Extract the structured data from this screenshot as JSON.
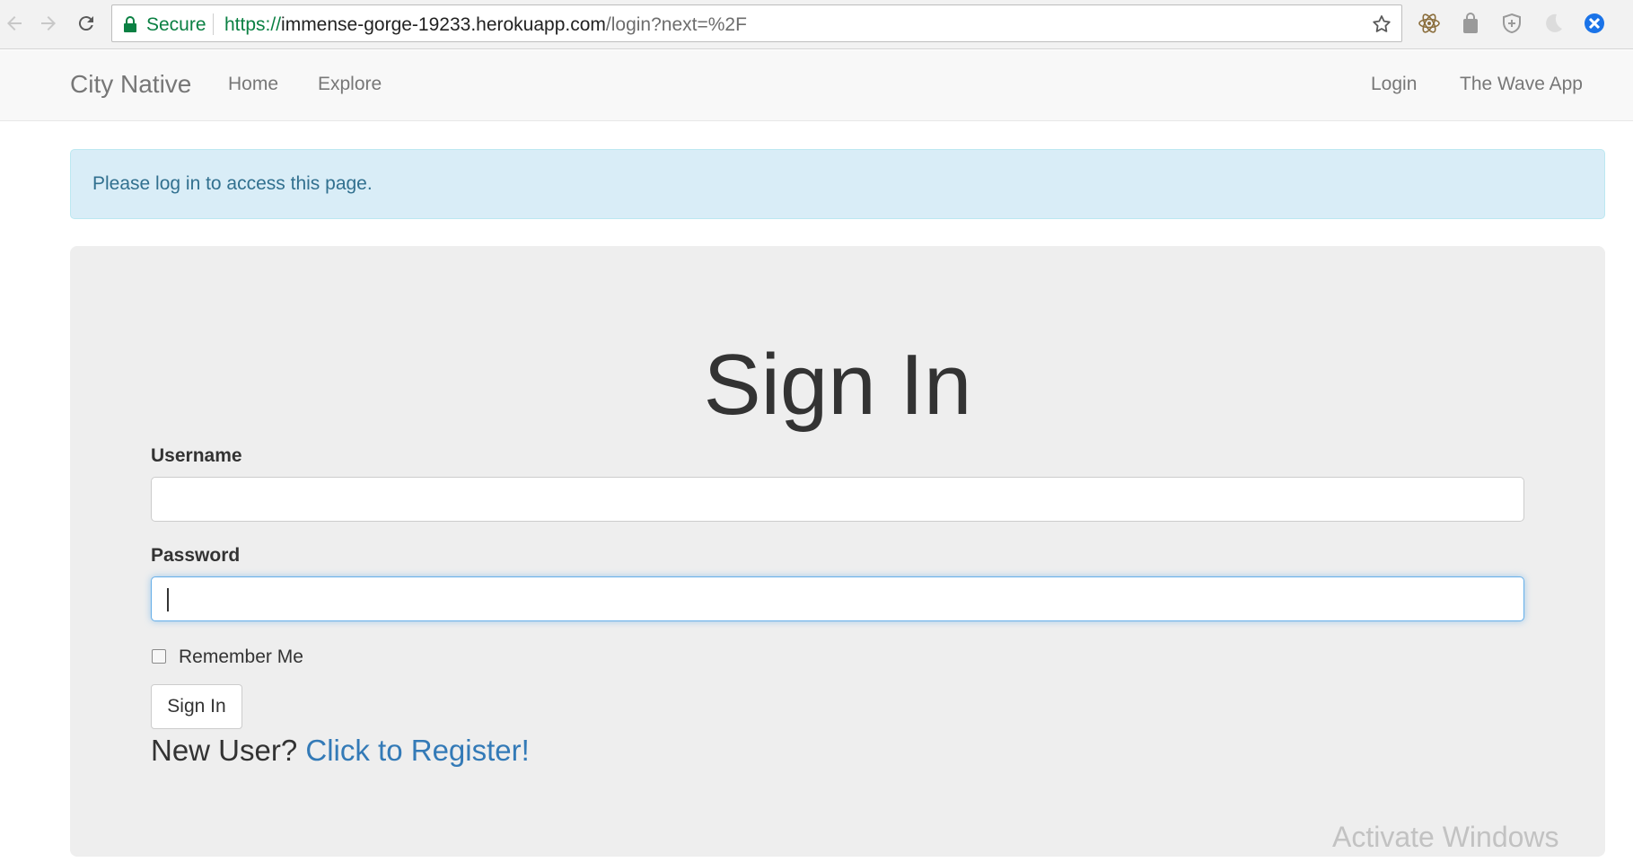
{
  "browser": {
    "secure_label": "Secure",
    "url_scheme": "https://",
    "url_host": "immense-gorge-19233.herokuapp.com",
    "url_path": "/login?next=%2F",
    "nav_icons": [
      "back-arrow-icon",
      "forward-arrow-icon",
      "reload-icon"
    ],
    "extension_icons": [
      "atom-icon",
      "shopping-bag-icon",
      "shield-icon",
      "crescent-icon",
      "blue-circle-icon"
    ]
  },
  "navbar": {
    "brand": "City Native",
    "left_links": [
      "Home",
      "Explore"
    ],
    "right_links": [
      "Login",
      "The Wave App"
    ]
  },
  "alert": {
    "message": "Please log in to access this page."
  },
  "form": {
    "title": "Sign In",
    "username_label": "Username",
    "username_value": "",
    "password_label": "Password",
    "password_value": "",
    "remember_label": "Remember Me",
    "remember_checked": false,
    "submit_label": "Sign In",
    "register_prompt": "New User?",
    "register_link": "Click to Register!"
  },
  "overlay": {
    "watermark": "Activate Windows"
  },
  "colors": {
    "secure_green": "#0b8043",
    "alert_bg": "#d9edf7",
    "alert_text": "#31708f",
    "link_blue": "#337ab7",
    "jumbotron_bg": "#eeeeee",
    "focus_border": "#66afe9"
  }
}
